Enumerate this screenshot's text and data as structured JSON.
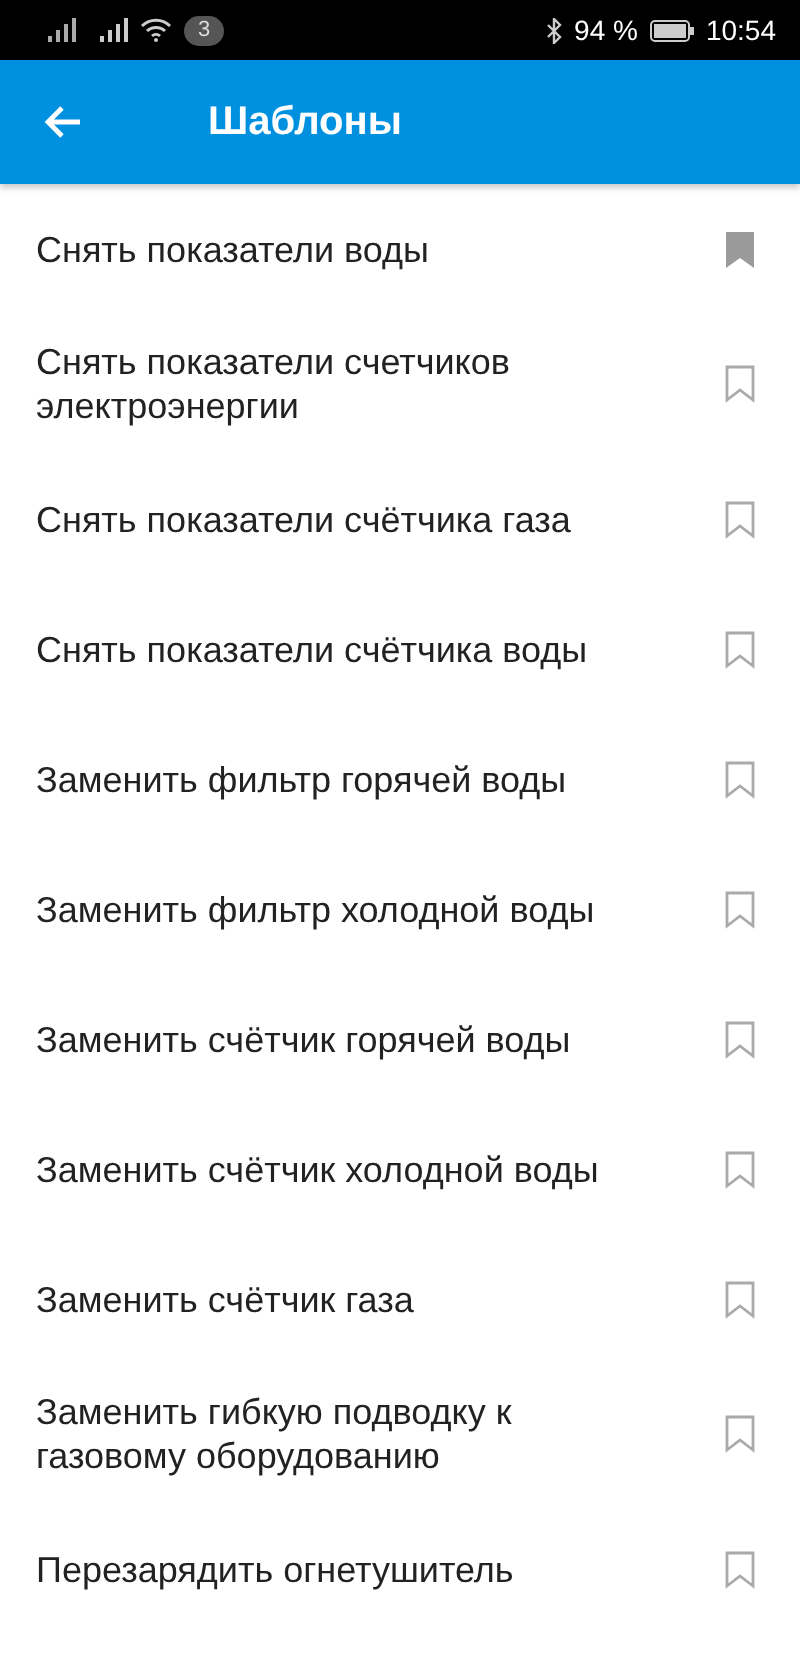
{
  "status_bar": {
    "notification_count": "3",
    "battery": "94 %",
    "time": "10:54"
  },
  "app_bar": {
    "title": "Шаблоны"
  },
  "items": [
    {
      "label": "Снять показатели воды",
      "bookmarked": true
    },
    {
      "label": "Снять показатели счетчиков электроэнергии",
      "bookmarked": false
    },
    {
      "label": "Снять показатели счётчика газа",
      "bookmarked": false
    },
    {
      "label": "Снять показатели счётчика воды",
      "bookmarked": false
    },
    {
      "label": "Заменить фильтр горячей воды",
      "bookmarked": false
    },
    {
      "label": "Заменить фильтр холодной воды",
      "bookmarked": false
    },
    {
      "label": "Заменить счётчик горячей воды",
      "bookmarked": false
    },
    {
      "label": "Заменить счётчик холодной воды",
      "bookmarked": false
    },
    {
      "label": "Заменить счётчик газа",
      "bookmarked": false
    },
    {
      "label": "Заменить гибкую подводку к газовому оборудованию",
      "bookmarked": false
    },
    {
      "label": "Перезарядить огнетушитель",
      "bookmarked": false
    }
  ]
}
